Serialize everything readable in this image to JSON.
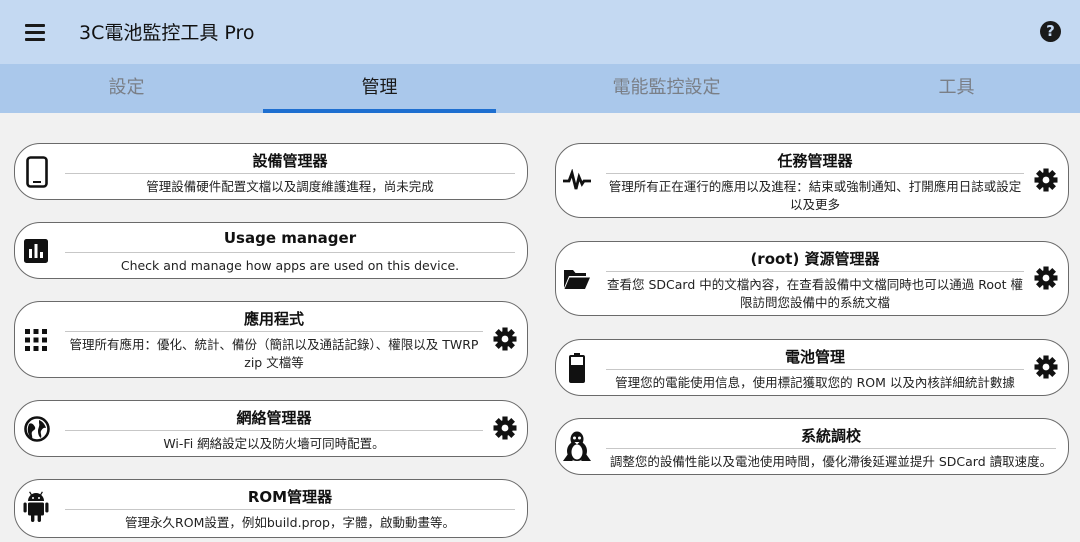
{
  "app": {
    "title": "3C電池監控工具 Pro"
  },
  "tabs": [
    "設定",
    "管理",
    "電能監控設定",
    "工具"
  ],
  "cards": {
    "device_manager": {
      "title": "設備管理器",
      "desc": "管理設備硬件配置文檔以及調度維護進程，尚未完成"
    },
    "usage_manager": {
      "title": "Usage manager",
      "desc": "Check and manage how apps are used on this device."
    },
    "app_manager": {
      "title": "應用程式",
      "desc": "管理所有應用：優化、統計、備份（簡訊以及通話記錄）、權限以及 TWRP zip 文檔等"
    },
    "network_manager": {
      "title": "網絡管理器",
      "desc": "Wi-Fi 網絡設定以及防火墻可同時配置。"
    },
    "rom_manager": {
      "title": "ROM管理器",
      "desc": "管理永久ROM設置，例如build.prop，字體，啟動動畫等。"
    },
    "task_manager": {
      "title": "任務管理器",
      "desc": "管理所有正在運行的應用以及進程：結束或強制通知、打開應用日誌或設定以及更多"
    },
    "root_explorer": {
      "title": "(root) 資源管理器",
      "desc": "查看您 SDCard 中的文檔內容，在查看設備中文檔同時也可以通過 Root 權限訪問您設備中的系統文檔"
    },
    "battery_manager": {
      "title": "電池管理",
      "desc": "管理您的電能使用信息，使用標記獲取您的 ROM 以及內核詳細統計數據"
    },
    "system_tuner": {
      "title": "系統調校",
      "desc": "調整您的設備性能以及電池使用時間，優化滯後延遲並提升 SDCard 讀取速度。"
    }
  },
  "colors": {
    "appbar": "#c4d9f2",
    "tabbar": "#aac8eb",
    "indicator": "#1e6fd0",
    "background": "#f1f1f1"
  }
}
